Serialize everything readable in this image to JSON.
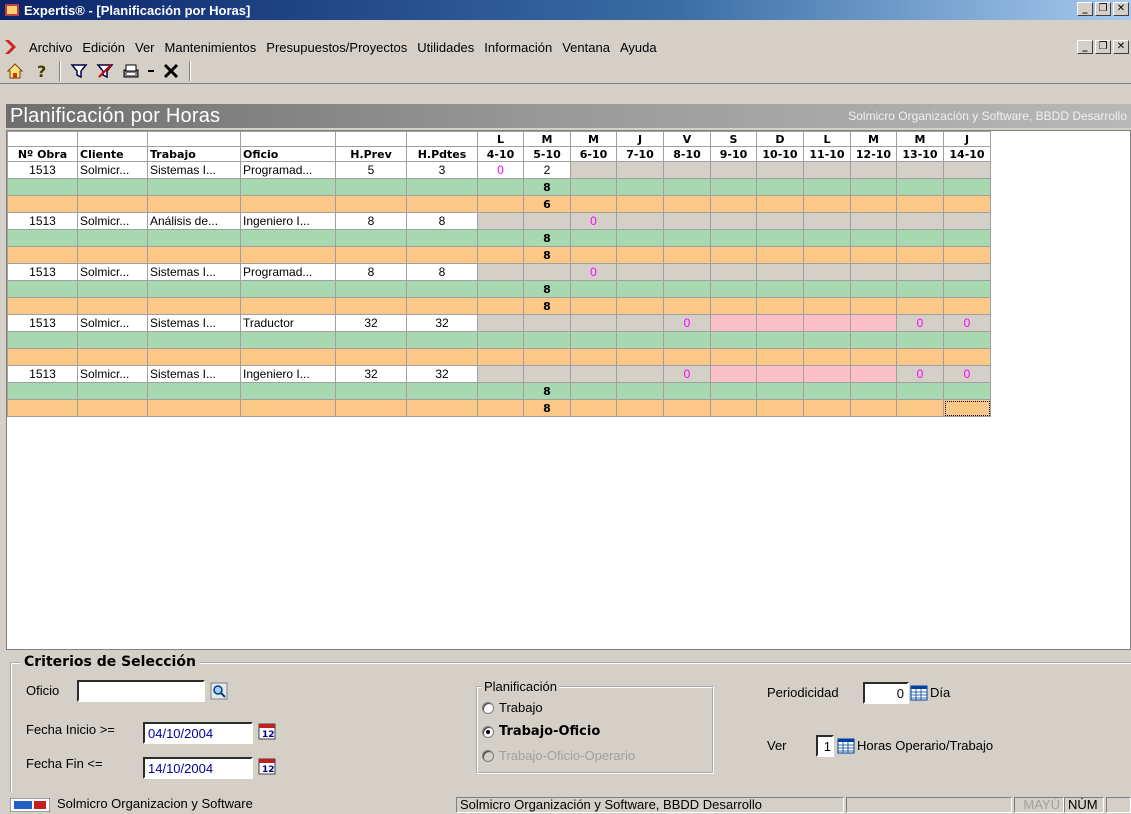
{
  "window": {
    "title": "Expertis® - [Planificación por Horas]",
    "controls": [
      "_",
      "❐",
      "✕"
    ]
  },
  "menu": {
    "items": [
      "Archivo",
      "Edición",
      "Ver",
      "Mantenimientos",
      "Presupuestos/Proyectos",
      "Utilidades",
      "Información",
      "Ventana",
      "Ayuda"
    ]
  },
  "toolbar": {
    "icons": [
      "home-icon",
      "help-icon",
      "filter-icon",
      "clear-filter-icon",
      "print-icon",
      "dropdown-arrow-icon",
      "close-x-icon"
    ]
  },
  "header": {
    "title": "Planificación por Horas",
    "company": "Solmicro Organización y Software, BBDD Desarrollo"
  },
  "grid": {
    "day_letters": [
      "L",
      "M",
      "M",
      "J",
      "V",
      "S",
      "D",
      "L",
      "M",
      "M",
      "J"
    ],
    "columns": [
      "Nº Obra",
      "Cliente",
      "Trabajo",
      "Oficio",
      "H.Prev",
      "H.Pdtes",
      "4-10",
      "5-10",
      "6-10",
      "7-10",
      "8-10",
      "9-10",
      "10-10",
      "11-10",
      "12-10",
      "13-10",
      "14-10"
    ],
    "rows": [
      {
        "obra": "1513",
        "cliente": "Solmicr...",
        "trabajo": "Sistemas I...",
        "oficio": "Programad...",
        "hprev": "5",
        "hpdtes": "3",
        "days": [
          "0",
          "2",
          "",
          "",
          "",
          "",
          "",
          "",
          "",
          "",
          ""
        ],
        "green": [
          "",
          "8",
          "",
          "",
          "",
          "",
          "",
          "",
          "",
          "",
          ""
        ],
        "orange": [
          "",
          "6",
          "",
          "",
          "",
          "",
          "",
          "",
          "",
          "",
          ""
        ]
      },
      {
        "obra": "1513",
        "cliente": "Solmicr...",
        "trabajo": "Análisis de...",
        "oficio": "Ingeniero I...",
        "hprev": "8",
        "hpdtes": "8",
        "days": [
          "",
          "",
          "0",
          "",
          "",
          "",
          "",
          "",
          "",
          "",
          ""
        ],
        "green": [
          "",
          "8",
          "",
          "",
          "",
          "",
          "",
          "",
          "",
          "",
          ""
        ],
        "orange": [
          "",
          "8",
          "",
          "",
          "",
          "",
          "",
          "",
          "",
          "",
          ""
        ]
      },
      {
        "obra": "1513",
        "cliente": "Solmicr...",
        "trabajo": "Sistemas I...",
        "oficio": "Programad...",
        "hprev": "8",
        "hpdtes": "8",
        "days": [
          "",
          "",
          "0",
          "",
          "",
          "",
          "",
          "",
          "",
          "",
          ""
        ],
        "green": [
          "",
          "8",
          "",
          "",
          "",
          "",
          "",
          "",
          "",
          "",
          ""
        ],
        "orange": [
          "",
          "8",
          "",
          "",
          "",
          "",
          "",
          "",
          "",
          "",
          ""
        ]
      },
      {
        "obra": "1513",
        "cliente": "Solmicr...",
        "trabajo": "Sistemas I...",
        "oficio": "Traductor",
        "hprev": "32",
        "hpdtes": "32",
        "days": [
          "",
          "",
          "",
          "",
          "0",
          "",
          "",
          "",
          "",
          "0",
          "0"
        ],
        "green": [
          "",
          "",
          "",
          "",
          "",
          "",
          "",
          "",
          "",
          "",
          ""
        ],
        "orange": [
          "",
          "",
          "",
          "",
          "",
          "",
          "",
          "",
          "",
          "",
          ""
        ]
      },
      {
        "obra": "1513",
        "cliente": "Solmicr...",
        "trabajo": "Sistemas I...",
        "oficio": "Ingeniero I...",
        "hprev": "32",
        "hpdtes": "32",
        "days": [
          "",
          "",
          "",
          "",
          "0",
          "",
          "",
          "",
          "",
          "0",
          "0"
        ],
        "green": [
          "",
          "8",
          "",
          "",
          "",
          "",
          "",
          "",
          "",
          "",
          ""
        ],
        "orange": [
          "",
          "8",
          "",
          "",
          "",
          "",
          "",
          "",
          "",
          "",
          ""
        ]
      }
    ]
  },
  "criteria": {
    "title": "Criterios de Selección",
    "oficio_label": "Oficio",
    "oficio_value": "",
    "fecha_inicio_label": "Fecha Inicio >=",
    "fecha_inicio_value": "04/10/2004",
    "fecha_fin_label": "Fecha Fin <=",
    "fecha_fin_value": "14/10/2004",
    "planificacion": {
      "title": "Planificación",
      "options": [
        "Trabajo",
        "Trabajo-Oficio",
        "Trabajo-Oficio-Operario"
      ],
      "selected": "Trabajo-Oficio"
    },
    "periodicidad_label": "Periodicidad",
    "periodicidad_value": "0",
    "periodicidad_unit": "Día",
    "ver_label": "Ver",
    "ver_value": "1",
    "ver_unit": "Horas Operario/Trabajo"
  },
  "statusbar": {
    "left": "Solmicro Organizacion y Software",
    "middle": "Solmicro Organización y Software, BBDD Desarrollo",
    "mayus": "MAYÚ",
    "num": "NÚM"
  }
}
